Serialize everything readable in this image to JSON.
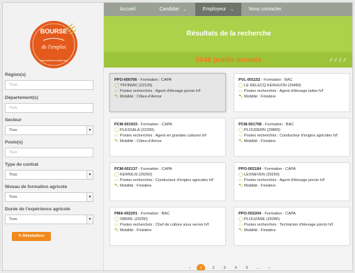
{
  "nav": {
    "items": [
      {
        "label": "Accueil"
      },
      {
        "label": "Candidat",
        "dropdown": true
      },
      {
        "label": "Employeur",
        "dropdown": true,
        "active": true
      },
      {
        "label": "Nous contacter"
      }
    ]
  },
  "logo": {
    "line1": "BOURSE",
    "line2": "de l'emploi",
    "line3": "www.aneta-emploi.org"
  },
  "filters": {
    "region": {
      "label": "Région(s)",
      "placeholder": "Tous"
    },
    "departement": {
      "label": "Département(s)",
      "placeholder": "Tous"
    },
    "secteur": {
      "label": "Secteur",
      "value": "Tous"
    },
    "postes": {
      "label": "Poste(s)",
      "placeholder": "Tous"
    },
    "contrat": {
      "label": "Type de contrat",
      "value": "Tous"
    },
    "formation": {
      "label": "Niveau de formation agricole",
      "value": "Tous"
    },
    "experience": {
      "label": "Durée de l'expérience agricole",
      "value": "Tous"
    },
    "reset_label": "↻ Réinitialiser"
  },
  "header": {
    "title": "Résultats de la recherche",
    "count": "5546 profils trouvés"
  },
  "cards": [
    {
      "id": "PPO-000706",
      "formation": "CAPA",
      "commune": "YFFINIAC (22120)",
      "postes": "Agent d'élevage porcin h/f",
      "mobilite": "Côtes-d'Armor",
      "selected": true
    },
    {
      "id": "PVL-001152",
      "formation": "BAC",
      "commune": "LE RELECQ KERHUON (29480)",
      "postes": "Agent d'élevage laitier h/f",
      "mobilite": "Finistère"
    },
    {
      "id": "PCM-001933",
      "formation": "CAPA",
      "commune": "PLESSALA (22330)",
      "postes": "Agent en grandes cultures h/f",
      "mobilite": "Côtes-d'Armor"
    },
    {
      "id": "PCM-001708",
      "formation": "BAC",
      "commune": "PLOUDERN (29800)",
      "postes": "Conducteur d'engins agricoles h/f",
      "mobilite": "Finistère"
    },
    {
      "id": "PCM-002137",
      "formation": "CAPA",
      "commune": "KERNILIS (29260)",
      "postes": "Conducteur d'engins agricoles h/f",
      "mobilite": "Finistère"
    },
    {
      "id": "PPO-002184",
      "formation": "CAPA",
      "commune": "LESNEVEN (29260)",
      "postes": "Agent d'élevage porcin h/f",
      "mobilite": "Finistère"
    },
    {
      "id": "PMA-002201",
      "formation": "BAC",
      "commune": "SIBIRIL (29250)",
      "postes": "Chef de culture sous serres h/f",
      "mobilite": "Finistère"
    },
    {
      "id": "PPO-002204",
      "formation": "CAPA",
      "commune": "PLOUZANE (29280)",
      "postes": "Technicien d'élevage porcin h/f",
      "mobilite": "Finistère"
    }
  ],
  "labels": {
    "formation_prefix": " - Formation : ",
    "postes_prefix": "Postes recherchés : ",
    "mobilite_prefix": "Mobilité : "
  },
  "pagination": {
    "prev": "‹",
    "pages": [
      "1",
      "2",
      "3",
      "4",
      "5",
      "...",
      "›"
    ],
    "current": "1"
  },
  "colors": {
    "nav": "#9aa095",
    "nav_active": "#6f746b",
    "green": "#acd14a",
    "green_dark": "#9cc43a",
    "orange": "#f08a1c"
  }
}
